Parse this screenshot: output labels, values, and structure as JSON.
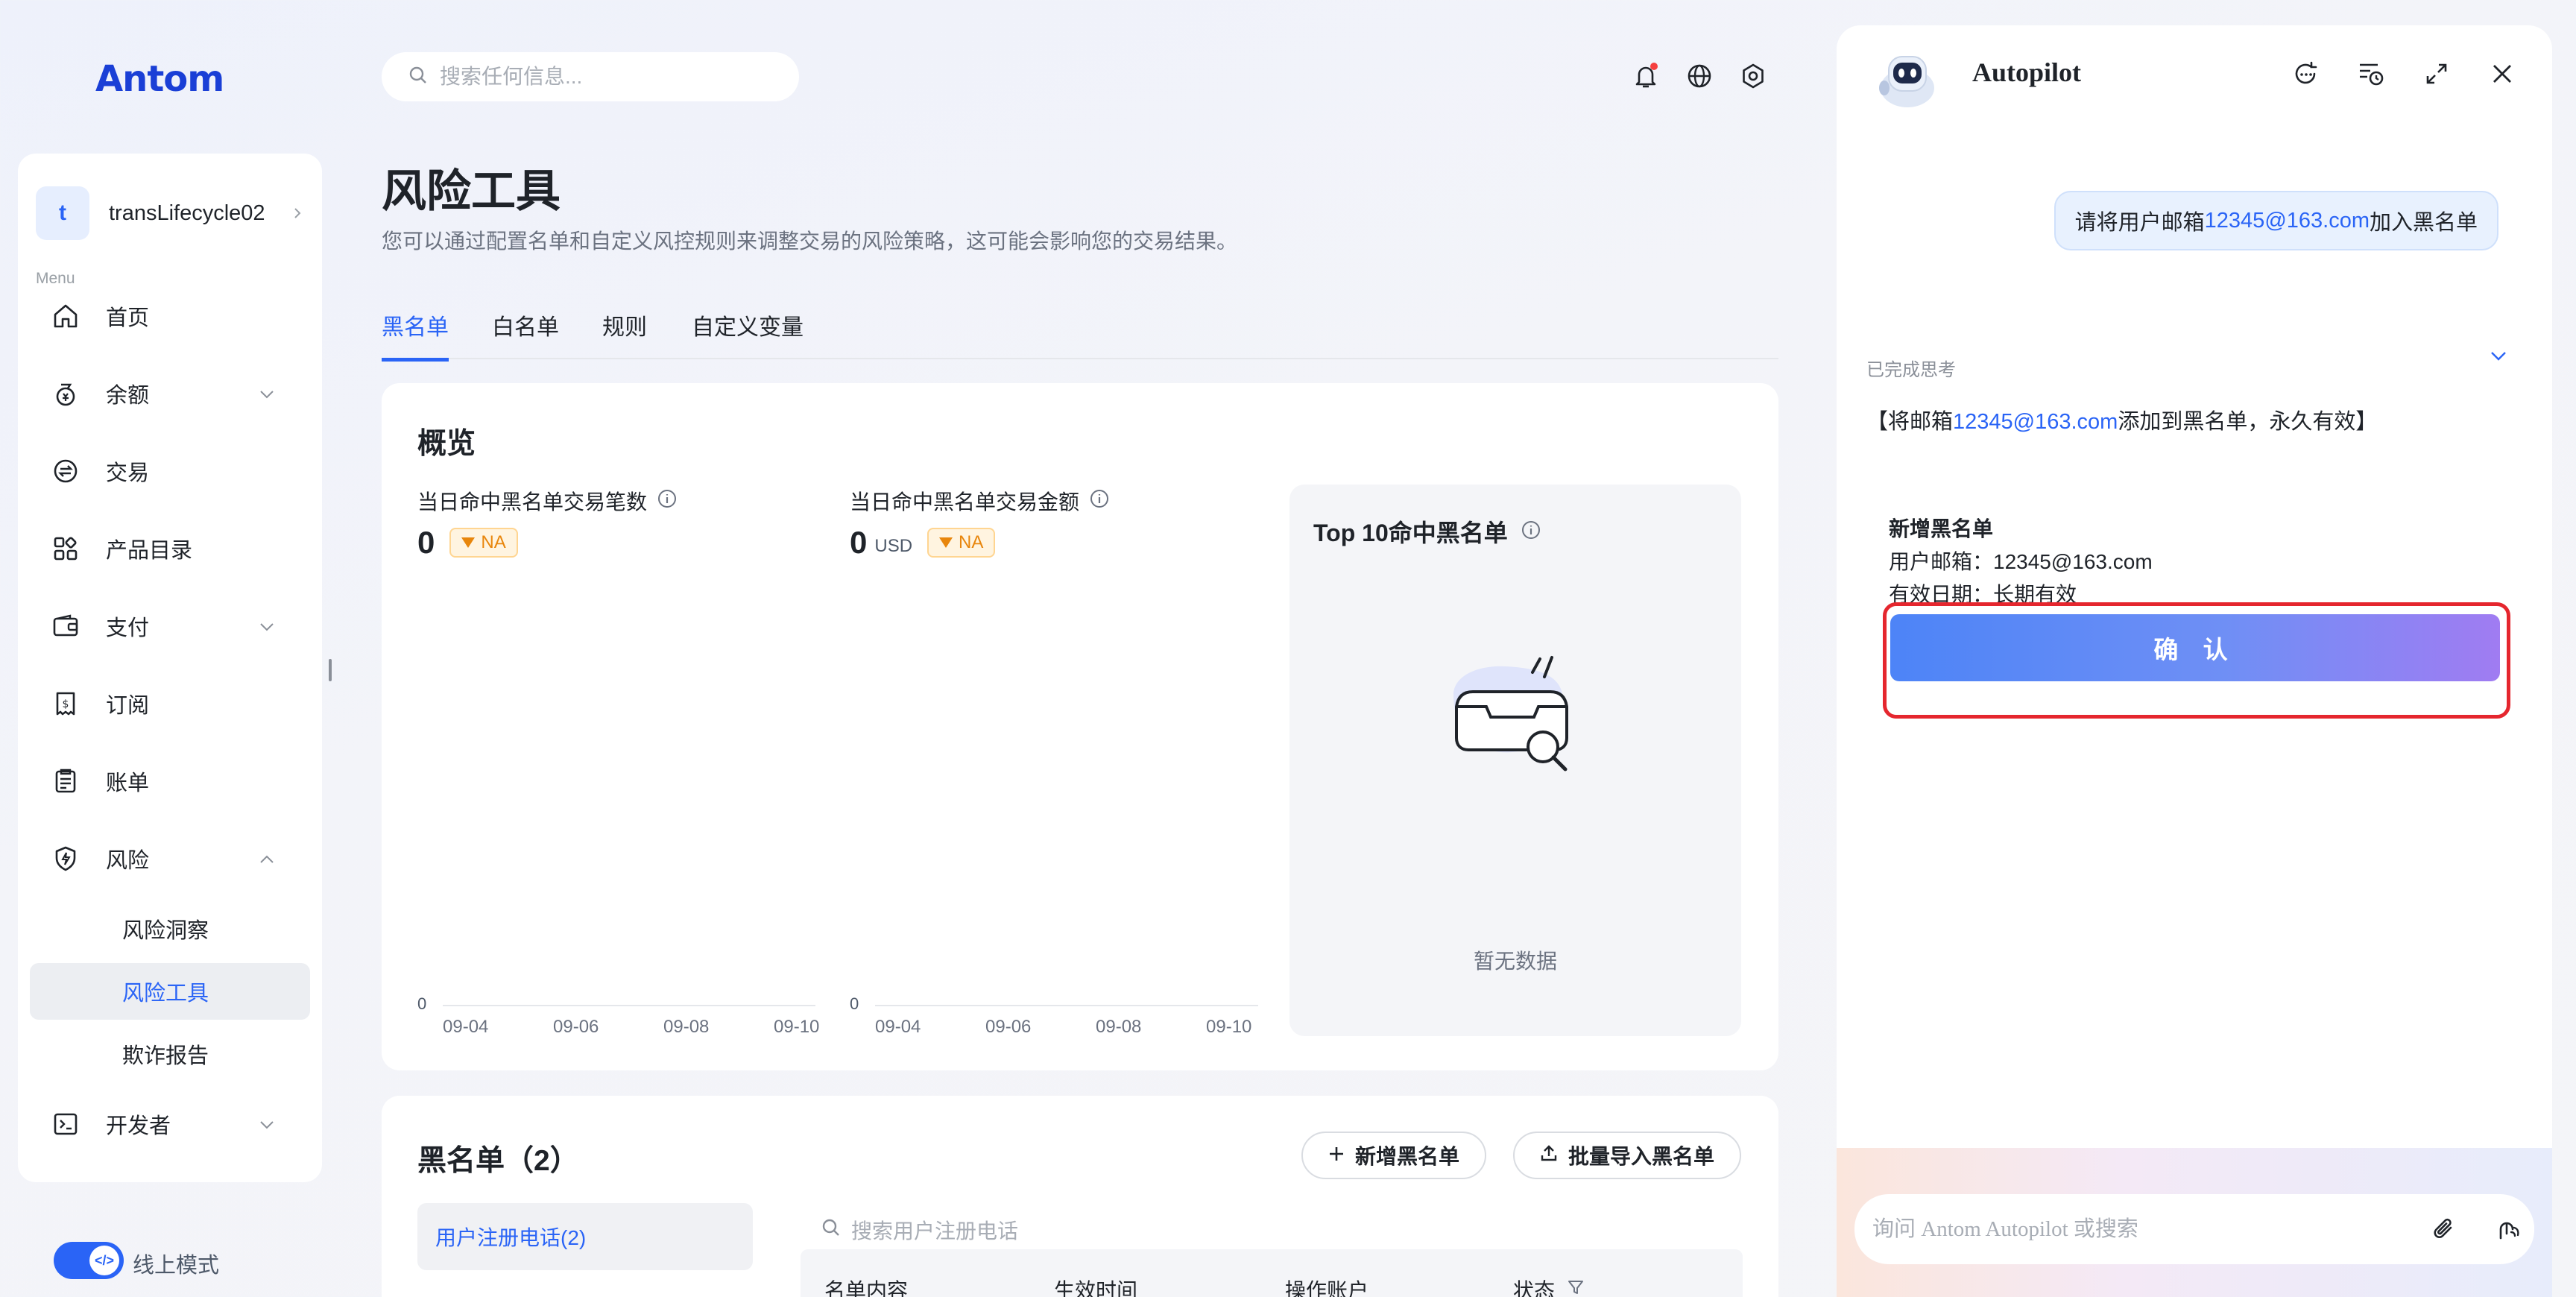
{
  "brand": {
    "logo_text": "Antom"
  },
  "account": {
    "avatar_letter": "t",
    "name": "transLifecycle02"
  },
  "sidebar": {
    "menu_label": "Menu",
    "items": [
      {
        "label": "首页",
        "icon": "home-icon"
      },
      {
        "label": "余额",
        "icon": "balance-icon",
        "expand": "chevron-down"
      },
      {
        "label": "交易",
        "icon": "transaction-icon"
      },
      {
        "label": "产品目录",
        "icon": "catalog-icon"
      },
      {
        "label": "支付",
        "icon": "wallet-icon",
        "expand": "chevron-down"
      },
      {
        "label": "订阅",
        "icon": "subscription-icon"
      },
      {
        "label": "账单",
        "icon": "bill-icon"
      },
      {
        "label": "风险",
        "icon": "shield-icon",
        "expand": "chevron-up"
      },
      {
        "label": "开发者",
        "icon": "terminal-icon",
        "expand": "chevron-down"
      }
    ],
    "risk_subitems": [
      {
        "label": "风险洞察",
        "active": false
      },
      {
        "label": "风险工具",
        "active": true
      },
      {
        "label": "欺诈报告",
        "active": false
      }
    ],
    "mode_toggle": {
      "label": "线上模式",
      "knob": "</>",
      "on": true
    }
  },
  "header": {
    "search_placeholder": "搜索任何信息...",
    "icons": [
      "bell-icon",
      "globe-icon",
      "gear-icon"
    ]
  },
  "page": {
    "title": "风险工具",
    "description": "您可以通过配置名单和自定义风控规则来调整交易的风险策略，这可能会影响您的交易结果。",
    "tabs": [
      {
        "label": "黑名单",
        "active": true
      },
      {
        "label": "白名单",
        "active": false
      },
      {
        "label": "规则",
        "active": false
      },
      {
        "label": "自定义变量",
        "active": false
      }
    ]
  },
  "overview": {
    "title": "概览",
    "metric1": {
      "label": "当日命中黑名单交易笔数",
      "value": "0",
      "unit": "",
      "badge": "NA"
    },
    "metric2": {
      "label": "当日命中黑名单交易金额",
      "value": "0",
      "unit": "USD",
      "badge": "NA"
    },
    "chart_data": [
      {
        "type": "line",
        "title": "当日命中黑名单交易笔数",
        "x": [
          "09-04",
          "09-06",
          "09-08",
          "09-10"
        ],
        "y_tick": "0",
        "series": []
      },
      {
        "type": "line",
        "title": "当日命中黑名单交易金额",
        "x": [
          "09-04",
          "09-06",
          "09-08",
          "09-10"
        ],
        "y_tick": "0",
        "series": []
      }
    ],
    "top10": {
      "title": "Top 10命中黑名单",
      "empty_text": "暂无数据"
    }
  },
  "blacklist": {
    "title": "黑名单（2）",
    "add_button": "新增黑名单",
    "import_button": "批量导入黑名单",
    "side_tab": "用户注册电话(2)",
    "search_placeholder": "搜索用户注册电话",
    "columns": [
      "名单内容",
      "生效时间",
      "操作账户",
      "状态"
    ]
  },
  "autopilot": {
    "title": "Autopilot",
    "user_message": {
      "prefix": "请将用户邮箱",
      "email": "12345@163.com",
      "suffix": "加入黑名单"
    },
    "thinking_label": "已完成思考",
    "reply": {
      "prefix": "【将邮箱",
      "email": "12345@163.com",
      "suffix": "添加到黑名单，永久有效】"
    },
    "confirm_card": {
      "title": "新增黑名单",
      "email_line": "用户邮箱：12345@163.com",
      "validity_line": "有效日期：长期有效",
      "confirm_label": "确 认"
    },
    "input_placeholder": "询问 Antom Autopilot 或搜索"
  },
  "colors": {
    "accent": "#2a64f6",
    "highlight_outline": "#e5262e",
    "badge_orange": "#e8860c"
  }
}
